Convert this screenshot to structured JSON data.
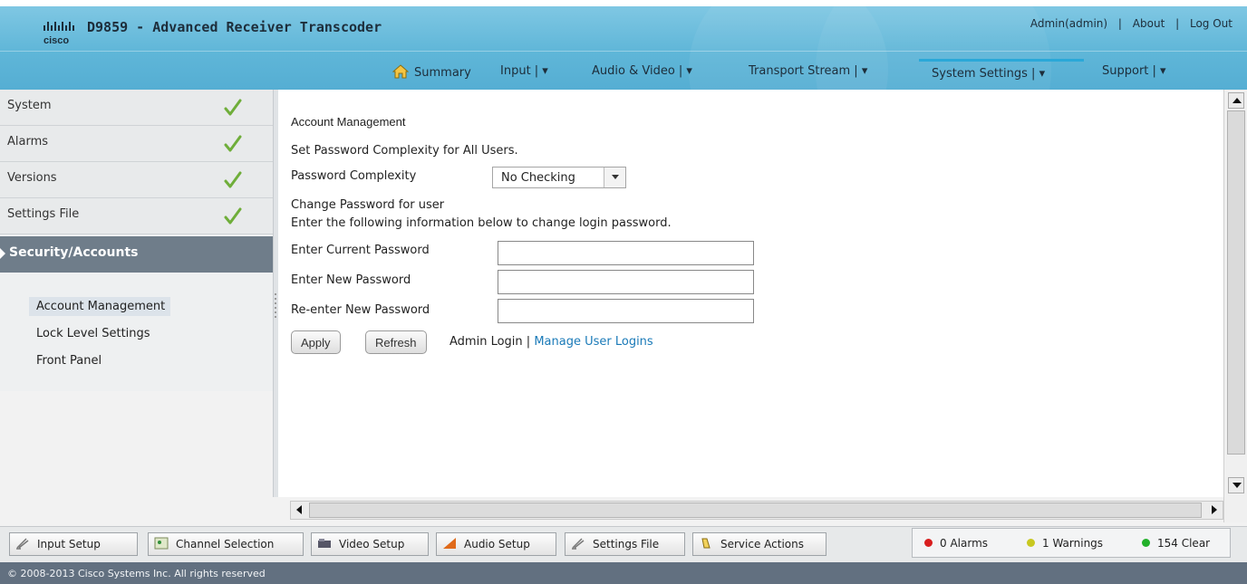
{
  "header": {
    "logo_text": "cisco",
    "app_title": "D9859 - Advanced Receiver Transcoder",
    "user_label": "Admin(admin)",
    "separator": "|",
    "about_label": "About",
    "logout_label": "Log Out"
  },
  "nav": {
    "items": [
      {
        "label": "Summary"
      },
      {
        "label": "Input | ▾"
      },
      {
        "label": "Audio & Video | ▾"
      },
      {
        "label": "Transport Stream | ▾"
      },
      {
        "label": "System Settings | ▾"
      },
      {
        "label": "Support | ▾"
      }
    ],
    "active": "System Settings"
  },
  "sidebar": {
    "sections": [
      {
        "label": "System",
        "status": "ok"
      },
      {
        "label": "Alarms",
        "status": "ok"
      },
      {
        "label": "Versions",
        "status": "ok"
      },
      {
        "label": "Settings File",
        "status": "ok"
      },
      {
        "label": "Security/Accounts",
        "active": true
      }
    ],
    "sub_items": [
      {
        "label": "Account Management",
        "selected": true
      },
      {
        "label": "Lock Level Settings"
      },
      {
        "label": "Front Panel"
      }
    ]
  },
  "main": {
    "title": "Account Management",
    "complexity_desc": "Set Password Complexity for All Users.",
    "complexity_label": "Password Complexity",
    "complexity_value": "No Checking",
    "change_pw_title": "Change Password for user",
    "change_pw_desc": "Enter the following information below to change login password.",
    "current_pw_label": "Enter Current Password",
    "new_pw_label": "Enter New Password",
    "reenter_pw_label": "Re-enter New Password",
    "apply_label": "Apply",
    "refresh_label": "Refresh",
    "admin_login_label": "Admin Login",
    "pipe": "|",
    "manage_logins_label": "Manage User Logins"
  },
  "toolbar": {
    "buttons": [
      {
        "label": "Input Setup",
        "icon": "input-setup-icon"
      },
      {
        "label": "Channel Selection",
        "icon": "channel-selection-icon"
      },
      {
        "label": "Video Setup",
        "icon": "video-setup-icon"
      },
      {
        "label": "Audio Setup",
        "icon": "audio-setup-icon"
      },
      {
        "label": "Settings File",
        "icon": "settings-file-icon"
      },
      {
        "label": "Service Actions",
        "icon": "service-actions-icon"
      }
    ],
    "status": {
      "alarms": "0 Alarms",
      "warnings": "1 Warnings",
      "clear": "154 Clear"
    },
    "colors": {
      "alarm": "#d81e1e",
      "warning": "#c8c820",
      "clear": "#22b02a"
    }
  },
  "footer": {
    "copyright": "© 2008-2013 Cisco Systems Inc. All rights reserved"
  },
  "theme": {
    "header_blue": "#5fb6d8",
    "sidebar_active": "#6f7d8a",
    "link": "#1a7ab8",
    "check_green": "#6fae3a"
  }
}
